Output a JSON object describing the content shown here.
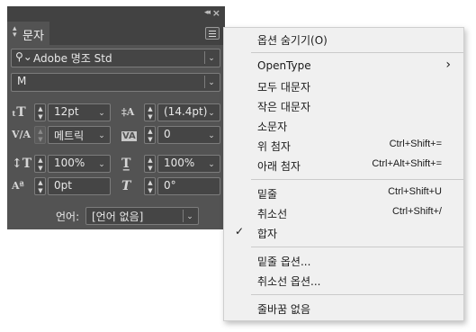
{
  "panel": {
    "tab_label": "문자",
    "font_family": "Adobe 명조 Std",
    "font_style": "M",
    "font_size": "12pt",
    "leading": "(14.4pt)",
    "kerning": "메트릭",
    "tracking": "0",
    "vertical_scale": "100%",
    "horizontal_scale": "100%",
    "baseline_shift": "0pt",
    "skew": "0°",
    "language_label": "언어:",
    "language_value": "[언어 없음]"
  },
  "menu": {
    "items": [
      {
        "label": "옵션 숨기기(O)",
        "shortcut": ""
      },
      {
        "label": "OpenType",
        "shortcut": "",
        "submenu": true
      },
      {
        "label": "모두 대문자",
        "shortcut": ""
      },
      {
        "label": "작은 대문자",
        "shortcut": ""
      },
      {
        "label": "소문자",
        "shortcut": ""
      },
      {
        "label": "위 첨자",
        "shortcut": "Ctrl+Shift+="
      },
      {
        "label": "아래 첨자",
        "shortcut": "Ctrl+Alt+Shift+="
      },
      {
        "label": "밑줄",
        "shortcut": "Ctrl+Shift+U"
      },
      {
        "label": "취소선",
        "shortcut": "Ctrl+Shift+/"
      },
      {
        "label": "합자",
        "shortcut": "",
        "checked": true
      },
      {
        "label": "밑줄 옵션...",
        "shortcut": ""
      },
      {
        "label": "취소선 옵션...",
        "shortcut": ""
      },
      {
        "label": "줄바꿈 없음",
        "shortcut": ""
      }
    ]
  }
}
